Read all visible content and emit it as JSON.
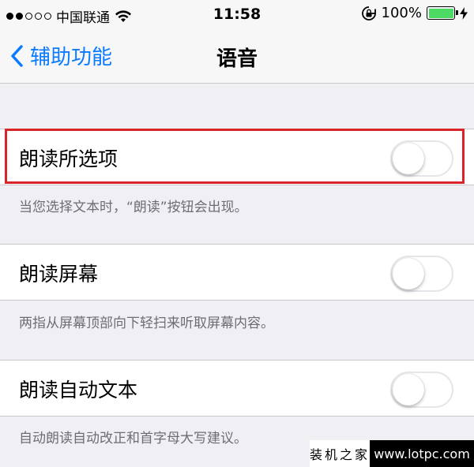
{
  "status_bar": {
    "carrier": "中国联通",
    "time": "11:58",
    "battery_percent": "100%",
    "battery_level": 1.0,
    "signal_bars": 2
  },
  "nav": {
    "back_label": "辅助功能",
    "title": "语音"
  },
  "settings": [
    {
      "label": "朗读所选项",
      "enabled": false,
      "footer": "当您选择文本时，“朗读”按钮会出现。"
    },
    {
      "label": "朗读屏幕",
      "enabled": false,
      "footer": "两指从屏幕顶部向下轻扫来听取屏幕内容。"
    },
    {
      "label": "朗读自动文本",
      "enabled": false,
      "footer": "自动朗读自动改正和首字母大写建议。"
    }
  ],
  "watermark": {
    "name": "装机之家",
    "url": "www.lotpc.com"
  },
  "colors": {
    "accent": "#0a7aff",
    "battery": "#4cd964",
    "highlight": "#d9252a",
    "background": "#efeff4"
  }
}
